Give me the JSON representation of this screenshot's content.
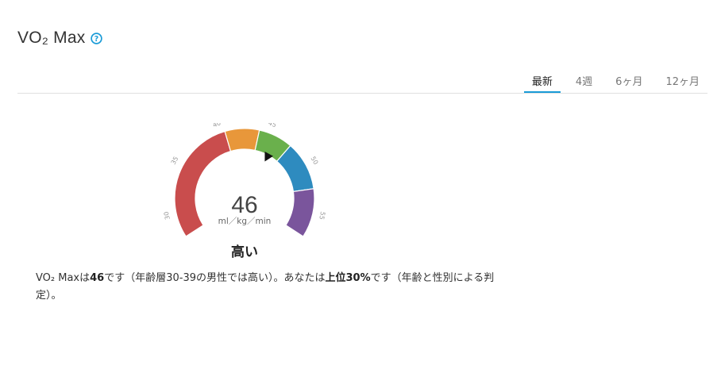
{
  "header": {
    "title": "VO₂ Max",
    "help_icon": "question-circle-icon",
    "help_icon_glyph": "?",
    "accent_color": "#1a9bd7"
  },
  "tabs": [
    {
      "label": "最新",
      "active": true
    },
    {
      "label": "4週",
      "active": false
    },
    {
      "label": "6ヶ月",
      "active": false
    },
    {
      "label": "12ヶ月",
      "active": false
    }
  ],
  "gauge": {
    "value": "46",
    "value_number": 46,
    "unit": "ml／kg／min",
    "rating": "高い",
    "scale_min": 27.5,
    "scale_max": 57.5,
    "ticks": [
      {
        "value": 30,
        "label": "30"
      },
      {
        "value": 35,
        "label": "35"
      },
      {
        "value": 40,
        "label": "40"
      },
      {
        "value": 45,
        "label": "45"
      },
      {
        "value": 50,
        "label": "50"
      },
      {
        "value": 55,
        "label": "55"
      }
    ],
    "segments": [
      {
        "from": 27.5,
        "to": 40.5,
        "color": "#c94d4d"
      },
      {
        "from": 40.5,
        "to": 44,
        "color": "#e8973a"
      },
      {
        "from": 44,
        "to": 47.5,
        "color": "#6ab04c"
      },
      {
        "from": 47.5,
        "to": 52.5,
        "color": "#2e8bbf"
      },
      {
        "from": 52.5,
        "to": 57.5,
        "color": "#7a559c"
      }
    ],
    "pointer_color": "#111111"
  },
  "description": {
    "p1": "VO₂ Maxは",
    "b1": "46",
    "p2": "です（年齢層30-39の男性では高い）。あなたは",
    "b2": "上位30%",
    "p3": "です（年齢と性別による判定）。"
  }
}
